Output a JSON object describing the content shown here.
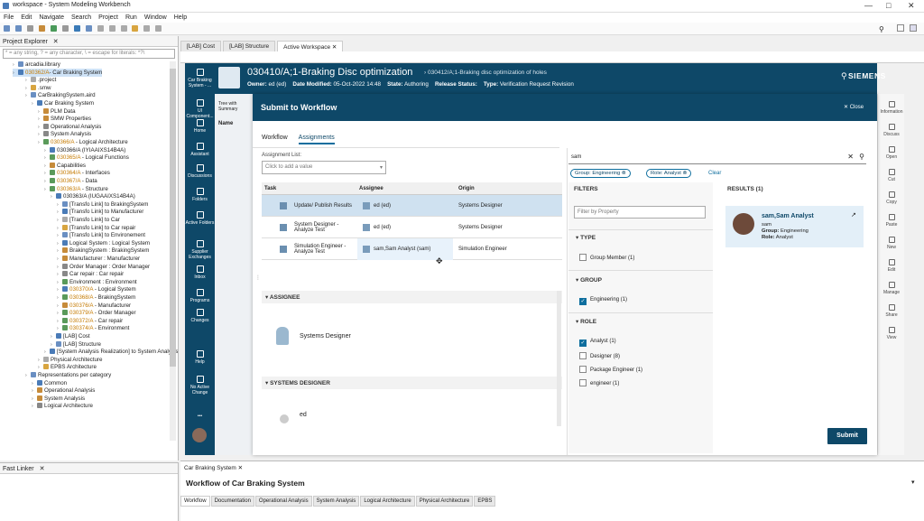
{
  "window": {
    "title": "workspace - System Modeling Workbench"
  },
  "menu": [
    "File",
    "Edit",
    "Navigate",
    "Search",
    "Project",
    "Run",
    "Window",
    "Help"
  ],
  "explorer": {
    "title": "Project Explorer",
    "filter_placeholder": "* = any string, ? = any character, \\ = escape for literals: *?\\",
    "items": [
      {
        "l": "arcadia.library",
        "v": ""
      },
      {
        "l": "- Car Braking System",
        "v": "030362/A"
      },
      {
        "l": ".project",
        "v": ""
      },
      {
        "l": ".smw",
        "v": ""
      },
      {
        "l": "CarBrakingSystem.aird",
        "v": ""
      },
      {
        "l": "Car Braking System",
        "v": ""
      },
      {
        "l": "PLM Data",
        "v": ""
      },
      {
        "l": "SMW Properties",
        "v": ""
      },
      {
        "l": "Operational Analysis",
        "v": ""
      },
      {
        "l": "System Analysis",
        "v": ""
      },
      {
        "l": " - Logical Architecture",
        "v": "030366/A"
      },
      {
        "l": "030366/A (IYIAAIXS14B4A)",
        "v": ""
      },
      {
        "l": " - Logical Functions",
        "v": "030365/A"
      },
      {
        "l": "Capabilities",
        "v": ""
      },
      {
        "l": " - Interfaces",
        "v": "030364/A"
      },
      {
        "l": " - Data",
        "v": "030367/A"
      },
      {
        "l": " - Structure",
        "v": "030363/A"
      },
      {
        "l": "030363/A (IUGAAIXS14B4A)",
        "v": ""
      },
      {
        "l": "[Transfo Link] to BrakingSystem",
        "v": ""
      },
      {
        "l": "[Transfo Link] to Manufacturer",
        "v": ""
      },
      {
        "l": "[Transfo Link] to Car",
        "v": ""
      },
      {
        "l": "[Transfo Link] to Car repair",
        "v": ""
      },
      {
        "l": "[Transfo Link] to Environement",
        "v": ""
      },
      {
        "l": "Logical System : Logical System",
        "v": ""
      },
      {
        "l": "BrakingSystem : BrakingSystem",
        "v": ""
      },
      {
        "l": "Manufacturer : Manufacturer",
        "v": ""
      },
      {
        "l": "Order Manager : Order Manager",
        "v": ""
      },
      {
        "l": "Car repair : Car repair",
        "v": ""
      },
      {
        "l": "Environment : Environment",
        "v": ""
      },
      {
        "l": " - Logical System",
        "v": "030370/A"
      },
      {
        "l": " - BrakingSystem",
        "v": "030368/A"
      },
      {
        "l": " - Manufacturer",
        "v": "030376/A"
      },
      {
        "l": " - Order Manager",
        "v": "030379/A"
      },
      {
        "l": " - Car repair",
        "v": "030372/A"
      },
      {
        "l": " - Environment",
        "v": "030374/A"
      },
      {
        "l": "[LAB] Cost",
        "v": ""
      },
      {
        "l": "[LAB] Structure",
        "v": ""
      },
      {
        "l": "[System Analysis Realization] to System Analysis",
        "v": ""
      },
      {
        "l": "Physical Architecture",
        "v": ""
      },
      {
        "l": "EPBS Architecture",
        "v": ""
      },
      {
        "l": "Representations per category",
        "v": ""
      },
      {
        "l": "Common",
        "v": ""
      },
      {
        "l": "Operational Analysis",
        "v": ""
      },
      {
        "l": "System Analysis",
        "v": ""
      },
      {
        "l": "Logical Architecture",
        "v": ""
      }
    ]
  },
  "fastlinker": {
    "title": "Fast Linker"
  },
  "editor_tabs": [
    "[LAB] Cost",
    "[LAB] Structure",
    "Active Workspace"
  ],
  "aw": {
    "title": "030410/A;1-Braking Disc optimization",
    "breadcrumb": "030412/A;1-Braking disc optimization of holes",
    "owner_label": "Owner:",
    "owner": "ed (ed)",
    "modified_label": "Date Modified:",
    "modified": "05-Oct-2022 14:48",
    "state_label": "State:",
    "state": "Authoring",
    "release_label": "Release Status:",
    "release": "",
    "type_label": "Type:",
    "type": "Verification Request Revision",
    "brand": "SIEMENS",
    "nav": [
      "Car Braking System - ...",
      "UI Component...",
      "Home",
      "Assistant",
      "Discussions",
      "Folders",
      "Active Folders",
      "Supplier Exchanges",
      "Inbox",
      "Programs",
      "Changes",
      "Help",
      "No Active Change"
    ],
    "right_nav": [
      "Information",
      "Discuss",
      "Open",
      "Cut",
      "Copy",
      "Paste",
      "New",
      "Edit",
      "Manage",
      "Share",
      "View"
    ],
    "bg_tree_label": "Tree with Summary",
    "bg_col": "Name"
  },
  "modal": {
    "title": "Submit to Workflow",
    "close": "Close",
    "tabs": [
      "Workflow",
      "Assignments"
    ],
    "assignment_list_label": "Assignment List:",
    "assignment_list_placeholder": "Click to add a value",
    "columns": [
      "Task",
      "Assignee",
      "Origin"
    ],
    "rows": [
      {
        "task": "Update/ Publish Results",
        "assignee": "ed (ed)",
        "origin": "Systems Designer"
      },
      {
        "task": "System Designer - Analyze Test",
        "assignee": "ed (ed)",
        "origin": "Systems Designer"
      },
      {
        "task": "Simulation Engineer - Analyze Test",
        "assignee": "sam,Sam Analyst (sam)",
        "origin": "Simulation Engineer"
      }
    ],
    "assignee_section": "ASSIGNEE",
    "assignee_name": "Systems Designer",
    "designer_section": "SYSTEMS DESIGNER",
    "designer_name": "ed",
    "search_value": "sam",
    "chips": [
      "Group: Engineering",
      "Role: Analyst"
    ],
    "clear": "Clear",
    "filters_title": "FILTERS",
    "filter_placeholder": "Filter by Property",
    "type_title": "TYPE",
    "type_items": [
      {
        "label": "Group Member (1)",
        "checked": false
      }
    ],
    "group_title": "GROUP",
    "group_items": [
      {
        "label": "Engineering (1)",
        "checked": true
      }
    ],
    "role_title": "ROLE",
    "role_items": [
      {
        "label": "Analyst (1)",
        "checked": true
      },
      {
        "label": "Designer (8)",
        "checked": false
      },
      {
        "label": "Package Engineer (1)",
        "checked": false
      },
      {
        "label": "engineer (1)",
        "checked": false
      }
    ],
    "results_title": "RESULTS (1)",
    "result": {
      "name": "sam,Sam Analyst",
      "id": "sam",
      "group_label": "Group:",
      "group": "Engineering",
      "role_label": "Role:",
      "role": "Analyst"
    },
    "submit": "Submit"
  },
  "bottom": {
    "tab": "Car Braking System",
    "title": "Workflow of Car Braking System",
    "tabs": [
      "Workflow",
      "Documentation",
      "Operational Analysis",
      "System Analysis",
      "Logical Architecture",
      "Physical Architecture",
      "EPBS"
    ]
  }
}
